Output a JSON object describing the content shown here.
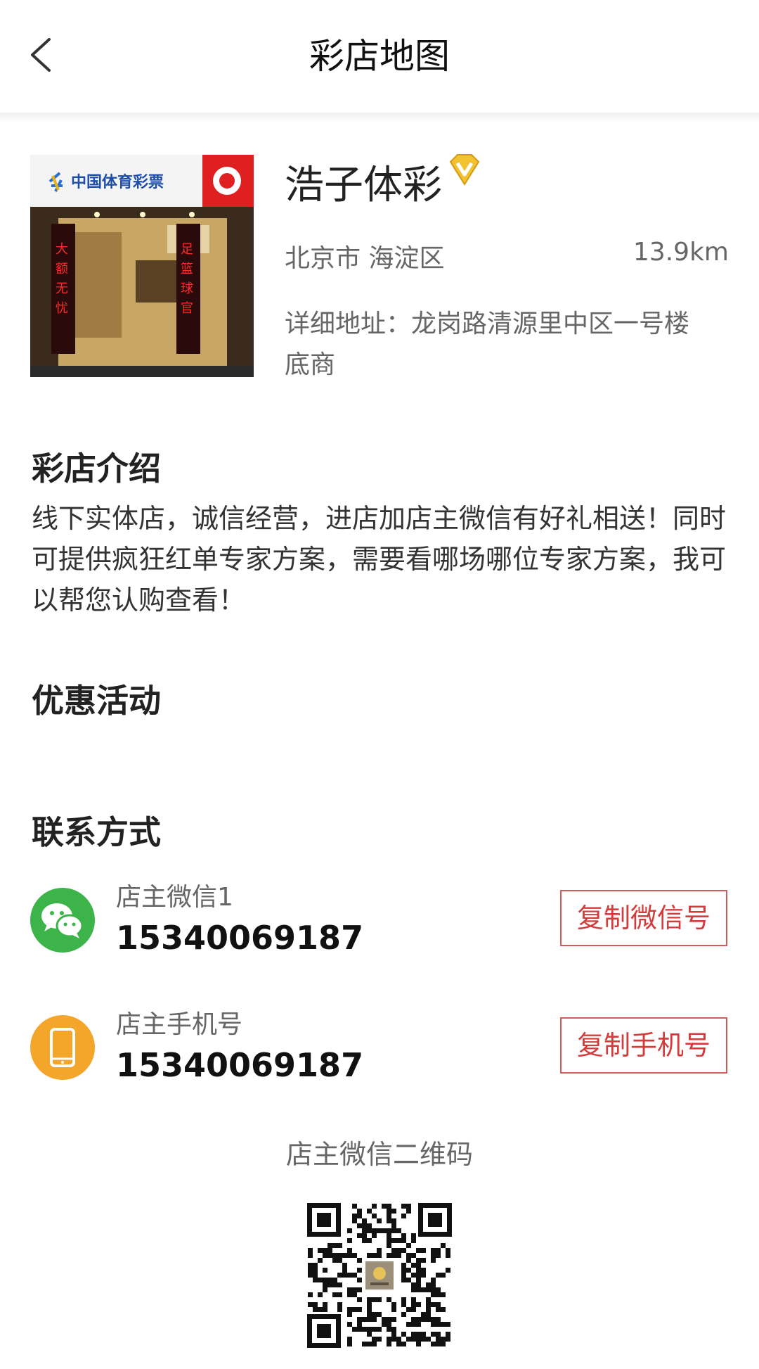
{
  "header": {
    "title": "彩店地图"
  },
  "store": {
    "name": "浩子体彩",
    "region": "北京市 海淀区",
    "distance": "13.9km",
    "address": "详细地址：龙岗路清源里中区一号楼底商",
    "photo": {
      "sign_text": "中国体育彩票",
      "left_banner": "大额无忧信誉保证",
      "right_banner": "足篮球官方投注站"
    }
  },
  "intro": {
    "title": "彩店介绍",
    "text": "线下实体店，诚信经营，进店加店主微信有好礼相送！同时可提供疯狂红单专家方案，需要看哪场哪位专家方案，我可以帮您认购查看！"
  },
  "promotion": {
    "title": "优惠活动"
  },
  "contact": {
    "title": "联系方式",
    "items": [
      {
        "label": "店主微信1",
        "value": "15340069187",
        "button": "复制微信号",
        "icon": "wechat-icon"
      },
      {
        "label": "店主手机号",
        "value": "15340069187",
        "button": "复制手机号",
        "icon": "phone-icon"
      }
    ]
  },
  "qr": {
    "caption": "店主微信二维码"
  },
  "colors": {
    "accent_red": "#d43c3c",
    "wechat_green": "#3cb44a",
    "phone_orange": "#f4a62a"
  }
}
